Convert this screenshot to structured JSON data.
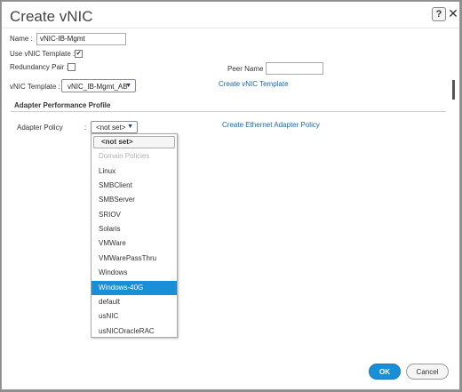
{
  "dialog": {
    "title": "Create vNIC",
    "help_glyph": "?",
    "close_glyph": "✕"
  },
  "form": {
    "name_label": "Name :",
    "name_value": "vNIC-IB-Mgmt",
    "use_template_label": "Use vNIC Template :",
    "use_template_checked": true,
    "check_glyph": "✔",
    "redundancy_label": "Redundancy Pair :",
    "redundancy_checked": false,
    "peer_name_label": "Peer Name :",
    "peer_name_value": "",
    "template_label": "vNIC Template :",
    "template_value": "vNIC_IB-Mgmt_AB",
    "create_template_link": "Create vNIC Template"
  },
  "adapter": {
    "section_title": "Adapter Performance Profile",
    "policy_label": "Adapter Policy",
    "colon": ":",
    "policy_value": "<not set>",
    "create_policy_link": "Create Ethernet Adapter Policy",
    "arrow_glyph": "▼"
  },
  "dropdown": {
    "options": [
      {
        "label": "<not set>",
        "kind": "current"
      },
      {
        "label": "Domain Policies",
        "kind": "header"
      },
      {
        "label": "Linux",
        "kind": "option"
      },
      {
        "label": "SMBClient",
        "kind": "option"
      },
      {
        "label": "SMBServer",
        "kind": "option"
      },
      {
        "label": "SRIOV",
        "kind": "option"
      },
      {
        "label": "Solaris",
        "kind": "option"
      },
      {
        "label": "VMWare",
        "kind": "option"
      },
      {
        "label": "VMWarePassThru",
        "kind": "option"
      },
      {
        "label": "Windows",
        "kind": "option"
      },
      {
        "label": "Windows-40G",
        "kind": "highlighted"
      },
      {
        "label": "default",
        "kind": "option"
      },
      {
        "label": "usNIC",
        "kind": "option"
      },
      {
        "label": "usNICOracleRAC",
        "kind": "option"
      }
    ]
  },
  "footer": {
    "ok_label": "OK",
    "cancel_label": "Cancel"
  },
  "colors": {
    "accent": "#1a8fd8",
    "link": "#1a66a6"
  }
}
